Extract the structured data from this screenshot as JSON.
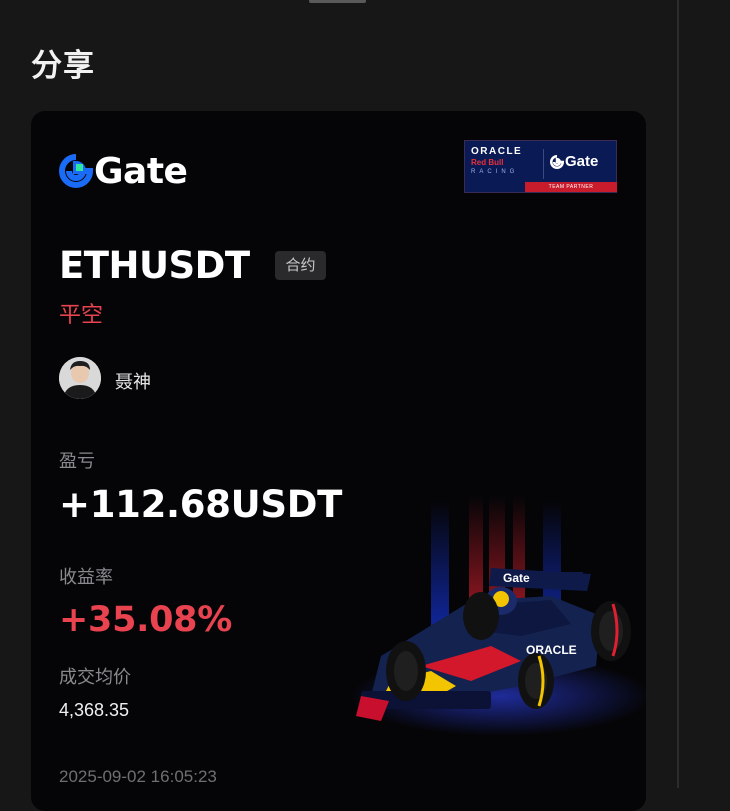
{
  "page": {
    "title": "分享"
  },
  "brand": {
    "name": "Gate"
  },
  "partner": {
    "oracle": "ORACLE",
    "redbull": "Red Bull",
    "racing": "RACING",
    "gate": "Gate",
    "band": "TEAM PARTNER"
  },
  "trade": {
    "symbol": "ETHUSDT",
    "type_tag": "合约",
    "direction": "平空",
    "username": "聂神",
    "pnl_label": "盈亏",
    "pnl_value": "+112.68USDT",
    "roi_label": "收益率",
    "roi_value": "+35.08%",
    "price_label": "成交均价",
    "price_value": "4,368.35",
    "timestamp": "2025-09-02 16:05:23"
  },
  "car_livery": {
    "wing_text": "Gate",
    "sidepod_text": "ORACLE"
  },
  "colors": {
    "background": "#171717",
    "card": "#050507",
    "brand_blue": "#1a6bf5",
    "brand_green": "#2ee6a0",
    "loss_red": "#e8434f",
    "muted_text": "#8a8a8e"
  }
}
